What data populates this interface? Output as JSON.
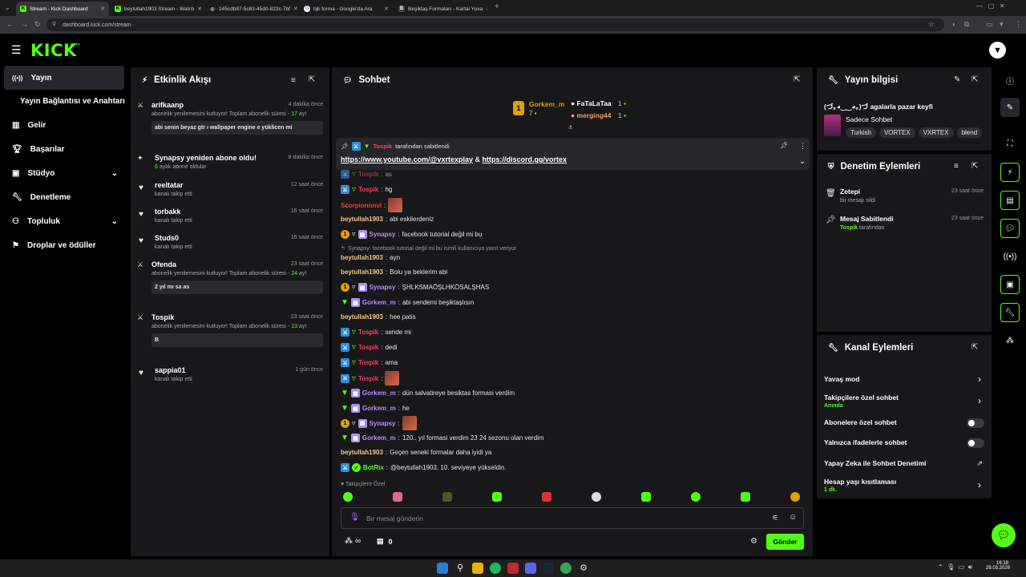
{
  "browser": {
    "tabs": [
      {
        "title": "Stream - Kick Dashboard",
        "active": true,
        "fav": "K"
      },
      {
        "title": "beytullah1903 Stream - Watch",
        "active": false,
        "fav": "K"
      },
      {
        "title": "245cdb87-5c83-45d0-822c-7bf",
        "active": false,
        "fav": "◎"
      },
      {
        "title": "bjk forma - Google'da Ara",
        "active": false,
        "fav": "G"
      },
      {
        "title": "Beşiktaş Formaları - Kartal Yuva",
        "active": false,
        "fav": "B"
      }
    ],
    "url": "dashboard.kick.com/stream"
  },
  "brand": {
    "logo": "KICK",
    "beta": "BETA"
  },
  "sidebar": {
    "items": [
      {
        "label": "Yayın",
        "icon": "broadcast-icon"
      },
      {
        "label": "Yayın Bağlantısı ve Anahtarı",
        "icon": ""
      },
      {
        "label": "Gelir",
        "icon": "chart-icon"
      },
      {
        "label": "Başarılar",
        "icon": "trophy-icon"
      },
      {
        "label": "Stüdyo",
        "icon": "studio-icon"
      },
      {
        "label": "Denetleme",
        "icon": "wrench-icon"
      },
      {
        "label": "Topluluk",
        "icon": "community-icon"
      },
      {
        "label": "Droplar ve ödüller",
        "icon": "drops-icon"
      }
    ]
  },
  "activity": {
    "title": "Etkinlik Akışı",
    "items": [
      {
        "name": "arifkaanp",
        "time": "4 dakika önce",
        "sub_pre": "abonelik yenilemesini kutluyor! Toplam abonelik süresi - ",
        "sub_num": "17",
        "sub_post": " ay!",
        "msg": "abi senin beyaz gtr ı wallpaper engine e yüklicen mi"
      },
      {
        "name": "Synapsy yeniden abone oldu!",
        "time": "8 dakika önce",
        "sub_num": "6",
        "sub_post": " aylık abone oldular"
      },
      {
        "name": "reeltatar",
        "time": "12 saat önce",
        "sub_pre": "kanalı takip etti"
      },
      {
        "name": "torbakk",
        "time": "16 saat önce",
        "sub_pre": "kanalı takip etti"
      },
      {
        "name": "Studs0",
        "time": "16 saat önce",
        "sub_pre": "kanalı takip etti"
      },
      {
        "name": "Ofenda",
        "time": "23 saat önce",
        "sub_pre": "abonelik yenilemesini kutluyor! Toplam abonelik süresi - ",
        "sub_num": "24",
        "sub_post": " ay!",
        "msg": "2 yıl mı sa as"
      },
      {
        "name": "Tospik",
        "time": "23 saat önce",
        "sub_pre": "abonelik yenilemesini kutluyor! Toplam abonelik süresi - ",
        "sub_num": "13",
        "sub_post": " ay!",
        "msg": "B"
      },
      {
        "name": "sappia01",
        "time": "1 gün önce",
        "sub_pre": "kanalı takip etti"
      }
    ]
  },
  "chat": {
    "title": "Sohbet",
    "top_gifters": [
      {
        "name": "Gorkem_m",
        "count": "7"
      },
      {
        "name": "FaTaLaTaa",
        "count": "1"
      },
      {
        "name": "merging44",
        "count": "1"
      }
    ],
    "pinned": {
      "by_user": "Tospik",
      "by_label": "tarafından sabitlendi",
      "link1": "https://www.youtube.com/@vxrtexplay",
      "amp": " & ",
      "link2": "https://discord.gg/vortex"
    },
    "reply_hint": "Synapsy: facebook tutorial değil mi bu isimli kullanıcıya yanıt veriyor",
    "messages": [
      {
        "user": "Tospik",
        "text": "as"
      },
      {
        "user": "Tospik",
        "text": "hg"
      },
      {
        "user": "Scorpionnnvl",
        "text": ""
      },
      {
        "user": "beytullah1903",
        "text": "abi eskilerdeniz"
      },
      {
        "user": "Synapsy",
        "text": "facebook tutorial değil mi bu"
      },
      {
        "user": "beytullah1903",
        "text": "ayn"
      },
      {
        "user": "beytullah1903",
        "text": "Bolu ya beklerim abi"
      },
      {
        "user": "Synapsy",
        "text": "ŞHLKSMAÖŞLHKÖSALŞHAS"
      },
      {
        "user": "Gorkem_m",
        "text": "abi sendemi beşiktaşlısın"
      },
      {
        "user": "beytullah1903",
        "text": "hee patis"
      },
      {
        "user": "Tospik",
        "text": "sende mi"
      },
      {
        "user": "Tospik",
        "text": "dedi"
      },
      {
        "user": "Tospik",
        "text": "ama"
      },
      {
        "user": "Tospik",
        "text": ""
      },
      {
        "user": "Gorkem_m",
        "text": "dün salvatireye besiktas formasi verdim"
      },
      {
        "user": "Gorkem_m",
        "text": "he"
      },
      {
        "user": "Synapsy",
        "text": ""
      },
      {
        "user": "Gorkem_m",
        "text": "120.. yıl formasi verdim 23 24 sezonu olan verdim"
      },
      {
        "user": "beytullah1903",
        "text": "Geçen seneki formalar daha iyidi ya"
      },
      {
        "user": "BotRix",
        "text": "@beytullah1903, 10. seviyeye yükseldin."
      }
    ],
    "followers_only": "Takipçilere Özel",
    "input_placeholder": "Bir mesaj gönderin",
    "points": "∞",
    "gift_count": "0",
    "send_label": "Gönder"
  },
  "stream_info": {
    "title": "Yayın bilgisi",
    "stream_title": "(づ｡◕‿‿◕｡)づ agalarla pazar keyfi",
    "category": "Sadece Sohbet",
    "tags": [
      "Turkish",
      "VORTEX",
      "VXRTEX",
      "blend"
    ]
  },
  "mod_actions": {
    "title": "Denetim Eylemleri",
    "items": [
      {
        "title": "Zetepi",
        "sub": "bir mesajı sildi",
        "time": "23 saat önce"
      },
      {
        "title": "Mesaj Sabitlendi",
        "sub_user": "Tospik",
        "sub": " tarafından",
        "time": "23 saat önce"
      }
    ]
  },
  "channel_actions": {
    "title": "Kanal Eylemleri",
    "items": [
      {
        "label": "Yavaş mod"
      },
      {
        "label": "Takipçilere özel sohbet",
        "sub": "Anında"
      },
      {
        "label": "Abonelere özel sohbet"
      },
      {
        "label": "Yalnızca ifadelerle sohbet"
      },
      {
        "label": "Yapay Zeka ile Sohbet Denetimi"
      },
      {
        "label": "Hesap yaşı kısıtlaması",
        "sub": "1 dk."
      }
    ]
  },
  "taskbar": {
    "time": "16:18",
    "date": "29.03.2026"
  },
  "colors": {
    "accent": "#53fc18",
    "panel": "#18181b",
    "mod_name": "#ff3b5c",
    "sub_name": "#b48cff",
    "gold_name": "#e0a100"
  }
}
